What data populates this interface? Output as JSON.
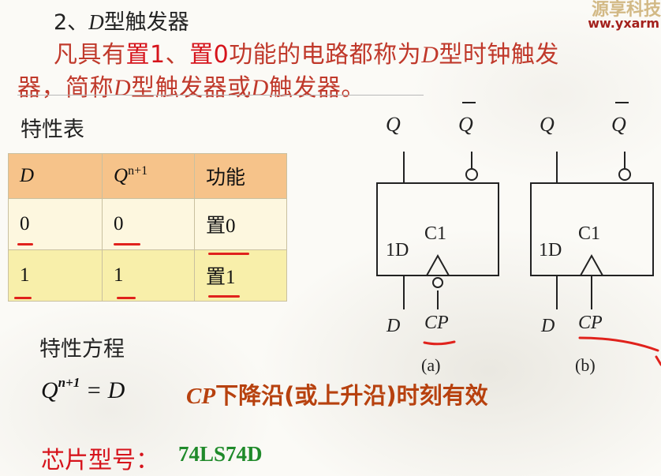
{
  "section": {
    "number": "2、",
    "var": "D",
    "title": "型触发器"
  },
  "definition": {
    "p1": "凡具有",
    "h1": "置1",
    "p2": "、",
    "h2": "置0",
    "p3": "功能的电路都称为",
    "v1": "D",
    "p4": "型时钟触发",
    "p5": "器，简称",
    "v2": "D",
    "p6": "型触发器或",
    "v3": "D",
    "p7": "触发器。"
  },
  "watermark": {
    "top": "源享科技",
    "url": "www.yxarm"
  },
  "table": {
    "heading": "特性表",
    "headers": {
      "d": "D",
      "q": "Q",
      "q_sup": "n+1",
      "func": "功能"
    },
    "rows": [
      {
        "d": "0",
        "q": "0",
        "func": "置0"
      },
      {
        "d": "1",
        "q": "1",
        "func": "置1"
      }
    ]
  },
  "equation": {
    "heading": "特性方程",
    "lhs": "Q",
    "sup": "n+1",
    "rhs": "= D",
    "note_cp": "CP",
    "note_rest": "下降沿(或上升沿)时刻有效"
  },
  "chip": {
    "label": "芯片型号：",
    "value": "74LS74D"
  },
  "diagram": {
    "a": {
      "q": "Q",
      "qbar": "Q",
      "d_in": "1D",
      "clk": "C1",
      "d": "D",
      "cp": "CP",
      "caption": "(a)"
    },
    "b": {
      "q": "Q",
      "qbar": "Q",
      "d_in": "1D",
      "clk": "C1",
      "d": "D",
      "cp": "CP",
      "caption": "(b)"
    }
  },
  "colors": {
    "definition": "#c0392b",
    "highlight": "#d6141c",
    "header_bg": "#f6c38a",
    "row_bg": "#f8efaa",
    "chip_value": "#1f8a2a",
    "annotation": "#e0221c"
  }
}
